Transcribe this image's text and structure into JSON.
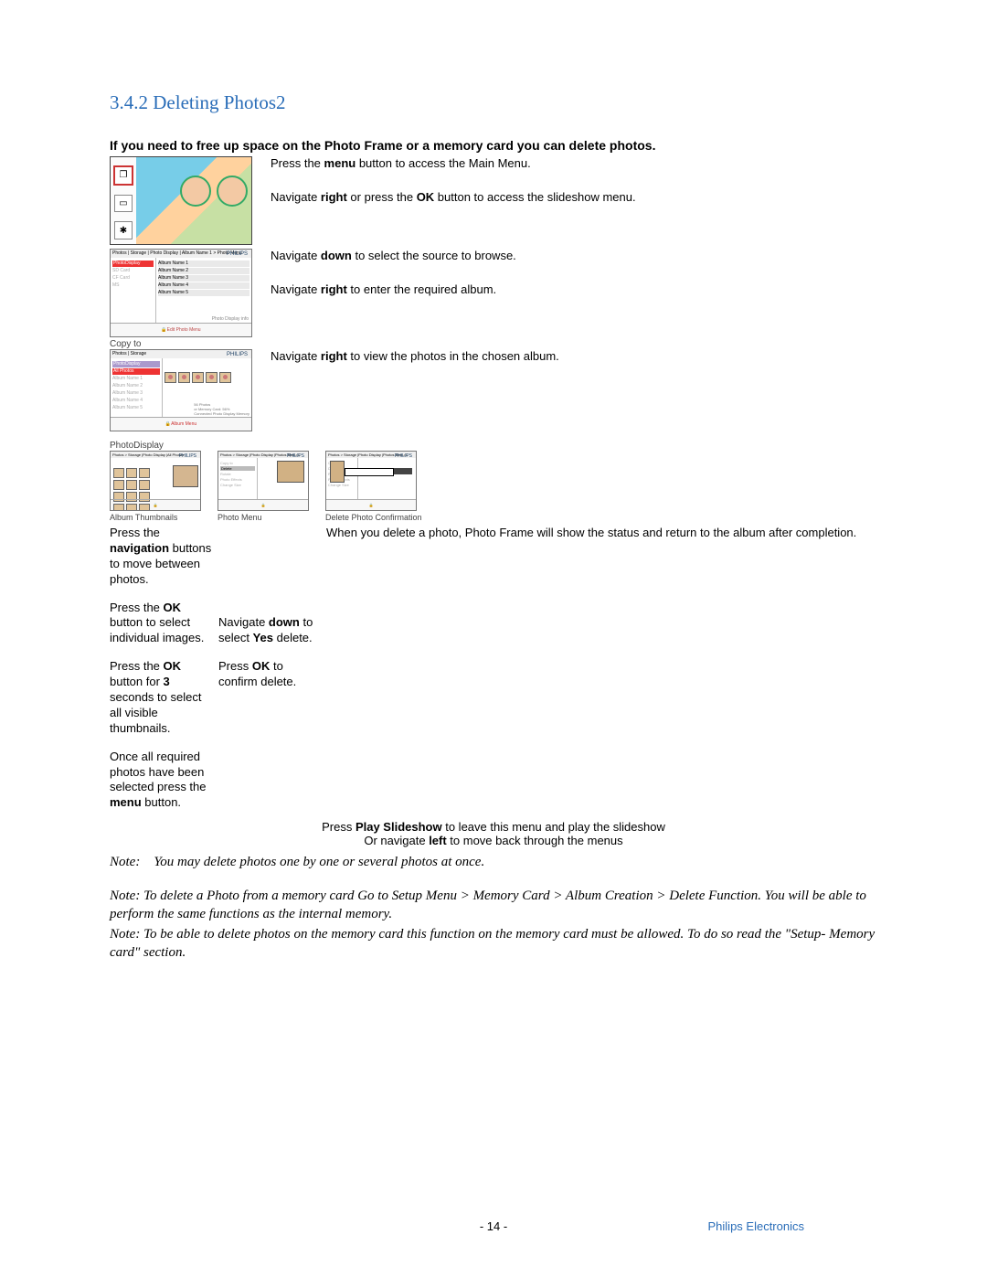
{
  "heading": "3.4.2 Deleting Photos2",
  "intro": "If you need to free up space on the Photo Frame or a memory card you can delete photos.",
  "step1a": "Press the ",
  "step1_bold": "menu",
  "step1b": " button to access the Main Menu.",
  "step2a": "Navigate ",
  "step2_bold1": "right",
  "step2b": " or press the ",
  "step2_bold2": "OK",
  "step2c": " button to access the slideshow menu.",
  "fig2": {
    "breadcrumb": "Photos | Storage | Photo Display | Album Name 1 > Photo Menu",
    "brand": "PHILIPS",
    "left_sel": "PhotoDisplay",
    "left_items": [
      "SD Card",
      "CF Card",
      "MS"
    ],
    "right_items": [
      "Album Name 1",
      "Album Name 2",
      "Album Name 3",
      "Album Name 4",
      "Album Name 5"
    ],
    "info": "Photo Display info",
    "foot": "Edit Photo Menu"
  },
  "step3a": "Navigate ",
  "step3_bold": "down",
  "step3b": " to select the source to browse.",
  "step4a": "Navigate ",
  "step4_bold": "right",
  "step4b": " to enter the required album.",
  "seg_copy": "Copy to",
  "fig3": {
    "breadcrumb": "Photos | Storage",
    "brand": "PHILIPS",
    "left_sel": "PhotoDisplay",
    "left_top": "All Photos",
    "left_items": [
      "Album Name 1",
      "Album Name 2",
      "Album Name 3",
      "Album Name 4",
      "Album Name 5"
    ],
    "info_lines": [
      "56 Photos",
      "or Memory Card: 56%",
      "Connected Photo Display Memory"
    ],
    "foot": "Album Menu"
  },
  "step5a": "Navigate ",
  "step5_bold": "right",
  "step5b": " to view the photos in the chosen album.",
  "seg_pd": "PhotoDisplay",
  "captions": {
    "c1": "Album Thumbnails",
    "c2": "Photo Menu",
    "c3": "Delete Photo Confirmation"
  },
  "mini_brand": "PHILIPS",
  "mini_hdr_a": "Photos > Storage |Photo Display |All Photos",
  "mini_hdr_b": "Photos > Storage |Photo Display |Photos Menu 1",
  "mini_b_items": [
    "Copy to",
    "Delete",
    "Rotate",
    "Photo Effects",
    "Change Size"
  ],
  "mini_c_items": [
    "Copy to",
    "Delete",
    "Rotate",
    "Photo Effects",
    "Change Size"
  ],
  "col1": {
    "p1a": "Press the ",
    "p1_bold": "navigation",
    "p1b": " buttons to move between photos.",
    "p2a": "Press the ",
    "p2_bold": "OK",
    "p2b": " button to select individual images.",
    "p3a": "Press the ",
    "p3_bold1": "OK",
    "p3b": " button for ",
    "p3_bold2": "3",
    "p3c": " seconds to select all visible thumbnails.",
    "p4a": "Once all required photos have been selected press the ",
    "p4_bold": "menu",
    "p4b": " button."
  },
  "col2": {
    "p1a": "Navigate ",
    "p1_bold1": "down",
    "p1b": " to select ",
    "p1_bold2": "Yes",
    "p1c": " delete.",
    "p2a": "Press ",
    "p2_bold": "OK",
    "p2b": " to confirm delete."
  },
  "col3": {
    "p1": "When you delete a photo, Photo Frame will show the status and return to the album after completion."
  },
  "center": {
    "l1a": "Press ",
    "l1_bold": "Play Slideshow",
    "l1b": " to leave this menu and play the slideshow",
    "l2a": "Or navigate ",
    "l2_bold": "left",
    "l2b": " to move back through the menus"
  },
  "notes": {
    "n1": "Note:    You may delete photos one by one or several photos at once.",
    "n2": "Note: To delete a Photo from a memory card Go to Setup Menu > Memory Card > Album Creation > Delete Function. You will be able to perform the same functions as the internal memory.",
    "n3": "Note: To be able to delete photos on the memory card this function on the memory card must be allowed. To do so read the \"Setup- Memory card\" section."
  },
  "footer": {
    "page": "- 14 -",
    "brand": "Philips Electronics"
  }
}
